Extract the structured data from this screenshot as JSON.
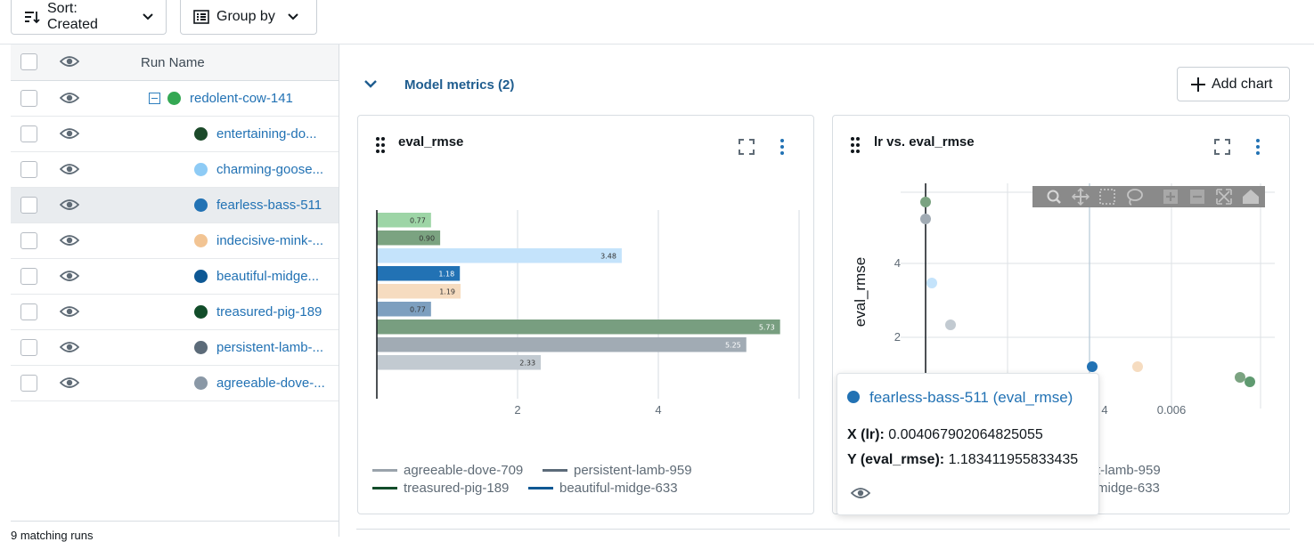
{
  "toolbar": {
    "sort_label": "Sort: Created",
    "group_label": "Group by"
  },
  "table": {
    "column_run_name": "Run Name",
    "parent": {
      "name": "redolent-cow-141",
      "color": "#34a853"
    },
    "runs": [
      {
        "name": "entertaining-do...",
        "color": "#1c4a2a"
      },
      {
        "name": "charming-goose...",
        "color": "#8ecbf5"
      },
      {
        "name": "fearless-bass-511",
        "color": "#2272b4"
      },
      {
        "name": "indecisive-mink-...",
        "color": "#f2c493"
      },
      {
        "name": "beautiful-midge...",
        "color": "#0e5894"
      },
      {
        "name": "treasured-pig-189",
        "color": "#124d2a"
      },
      {
        "name": "persistent-lamb-...",
        "color": "#5c6b79"
      },
      {
        "name": "agreeable-dove-...",
        "color": "#8a98a6"
      }
    ],
    "footer": "9 matching runs"
  },
  "section": {
    "title": "Model metrics (2)",
    "add_chart_label": "Add chart"
  },
  "charts": {
    "bar_title": "eval_rmse",
    "scatter_title": "lr vs. eval_rmse",
    "scatter_ylabel": "eval_rmse"
  },
  "legend": [
    {
      "name": "agreeable-dove-709",
      "color": "#9aa3ab"
    },
    {
      "name": "persistent-lamb-959",
      "color": "#5c6b79"
    },
    {
      "name": "treasured-pig-189",
      "color": "#124d2a"
    },
    {
      "name": "beautiful-midge-633",
      "color": "#0e5894"
    }
  ],
  "legend2_partial": [
    "t-lamb-959",
    "midge-633"
  ],
  "tooltip": {
    "title": "fearless-bass-511 (eval_rmse)",
    "color": "#2272b4",
    "x_label": "X (lr):",
    "x_value": "0.004067902064825055",
    "y_label": "Y (eval_rmse):",
    "y_value": "1.183411955833435"
  },
  "chart_data": [
    {
      "type": "bar",
      "title": "eval_rmse",
      "orientation": "horizontal",
      "xlim": [
        0,
        6
      ],
      "xticks": [
        "2",
        "4"
      ],
      "bars": [
        {
          "value": 0.77,
          "label": "0.77",
          "color": "#9dd5a6"
        },
        {
          "value": 0.9,
          "label": "0.90",
          "color": "#7ba381"
        },
        {
          "value": 3.48,
          "label": "3.48",
          "color": "#c4e3fb"
        },
        {
          "value": 1.18,
          "label": "1.18",
          "color": "#2272b4"
        },
        {
          "value": 1.19,
          "label": "1.19",
          "color": "#f6dcc0"
        },
        {
          "value": 0.77,
          "label": "0.77",
          "color": "#7d9fbf"
        },
        {
          "value": 5.73,
          "label": "5.73",
          "color": "#789e80"
        },
        {
          "value": 5.25,
          "label": "5.25",
          "color": "#a1abb4"
        },
        {
          "value": 2.33,
          "label": "2.33",
          "color": "#c2cad1"
        }
      ]
    },
    {
      "type": "scatter",
      "title": "lr vs. eval_rmse",
      "ylabel": "eval_rmse",
      "xlim": [
        0.0,
        0.0078
      ],
      "ylim": [
        0.2,
        6.0
      ],
      "xticks": [
        "4",
        "0.006"
      ],
      "yticks": [
        "4",
        "2"
      ],
      "points": [
        {
          "x": 0.0,
          "y": 5.73,
          "color": "#7ba381"
        },
        {
          "x": 0.0,
          "y": 5.25,
          "color": "#a1abb4"
        },
        {
          "x": 0.0001,
          "y": 3.48,
          "color": "#c4e3fb"
        },
        {
          "x": 0.0005,
          "y": 2.33,
          "color": "#c2cad1"
        },
        {
          "x": 0.004068,
          "y": 1.18,
          "color": "#2272b4"
        },
        {
          "x": 0.0047,
          "y": 1.19,
          "color": "#f6dcc0"
        },
        {
          "x": 0.007,
          "y": 0.9,
          "color": "#7ba381"
        },
        {
          "x": 0.0072,
          "y": 0.77,
          "color": "#5f9a70"
        }
      ]
    }
  ]
}
